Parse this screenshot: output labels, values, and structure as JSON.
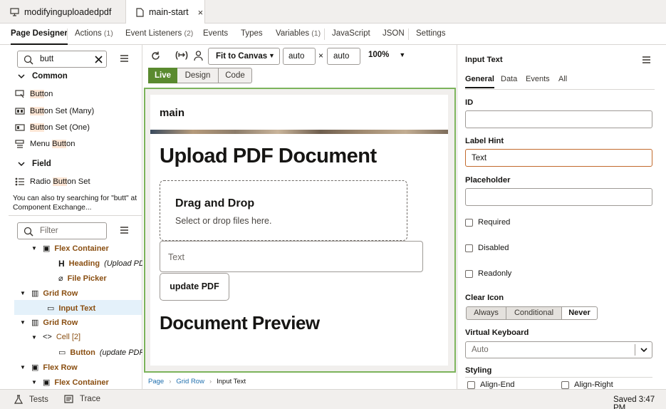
{
  "file_tabs": [
    {
      "label": "modifyinguploadedpdf",
      "icon": "desktop-icon"
    },
    {
      "label": "main-start",
      "icon": "document-icon",
      "close": "×"
    }
  ],
  "nav_tabs": [
    {
      "label": "Page Designer"
    },
    {
      "label": "Actions",
      "count": "(1)"
    },
    {
      "label": "Event Listeners",
      "count": "(2)"
    },
    {
      "label": "Events"
    },
    {
      "label": "Types"
    },
    {
      "label": "Variables",
      "count": "(1)"
    },
    {
      "label": "JavaScript"
    },
    {
      "label": "JSON"
    },
    {
      "label": "Settings"
    }
  ],
  "components": {
    "search_value": "butt",
    "sections": [
      {
        "label": "Common"
      },
      {
        "label": "Field"
      }
    ],
    "items": [
      {
        "pre": "",
        "match": "Butt",
        "post": "on"
      },
      {
        "pre": "",
        "match": "Butt",
        "post": "on Set (Many)"
      },
      {
        "pre": "",
        "match": "Butt",
        "post": "on Set (One)"
      },
      {
        "pre": "Menu ",
        "match": "Butt",
        "post": "on"
      },
      {
        "pre": "Radio ",
        "match": "Butt",
        "post": "on Set"
      }
    ],
    "hint_line1": "You can also try searching for \"butt\" at",
    "hint_line2": "Component Exchange..."
  },
  "structure": {
    "filter_placeholder": "Filter",
    "nodes": [
      {
        "label": "Flex Container"
      },
      {
        "label": "Heading",
        "detail": "(Upload PDF"
      },
      {
        "label": "File Picker"
      },
      {
        "label": "Grid Row"
      },
      {
        "label": "Input Text"
      },
      {
        "label": "Grid Row"
      },
      {
        "label": "Cell [2]"
      },
      {
        "label": "Button",
        "detail": "(update PDF)"
      },
      {
        "label": "Flex Row"
      },
      {
        "label": "Flex Container"
      }
    ]
  },
  "toolbar": {
    "fit": "Fit to Canvas",
    "width": "auto",
    "times": "×",
    "height": "auto",
    "zoom": "100%",
    "modes": [
      "Live",
      "Design",
      "Code"
    ]
  },
  "canvas": {
    "page_title": "main",
    "heading": "Upload PDF Document",
    "drop_title": "Drag and Drop",
    "drop_sub": "Select or drop files here.",
    "input_label": "Text",
    "button": "update PDF",
    "preview_heading": "Document Preview"
  },
  "breadcrumbs": [
    "Page",
    "Grid Row",
    "Input Text"
  ],
  "props": {
    "title": "Input Text",
    "tabs": [
      "General",
      "Data",
      "Events",
      "All"
    ],
    "id_label": "ID",
    "id_value": "",
    "label_hint_label": "Label Hint",
    "label_hint_value": "Text",
    "placeholder_label": "Placeholder",
    "placeholder_value": "",
    "checkboxes": [
      "Required",
      "Disabled",
      "Readonly"
    ],
    "clear_icon_label": "Clear Icon",
    "clear_icon_options": [
      "Always",
      "Conditional",
      "Never"
    ],
    "clear_icon_selected": "Never",
    "vk_label": "Virtual Keyboard",
    "vk_value": "Auto",
    "styling_label": "Styling",
    "align": [
      "Align-End",
      "Align-Right"
    ]
  },
  "status": {
    "tests": "Tests",
    "trace": "Trace",
    "saved": "Saved 3:47 PM"
  },
  "colors": {
    "live_green": "#5a8a2f",
    "canvas_border": "#7cb35b",
    "tree_orange": "#8a4f12",
    "focus_border": "#c26a2c"
  }
}
